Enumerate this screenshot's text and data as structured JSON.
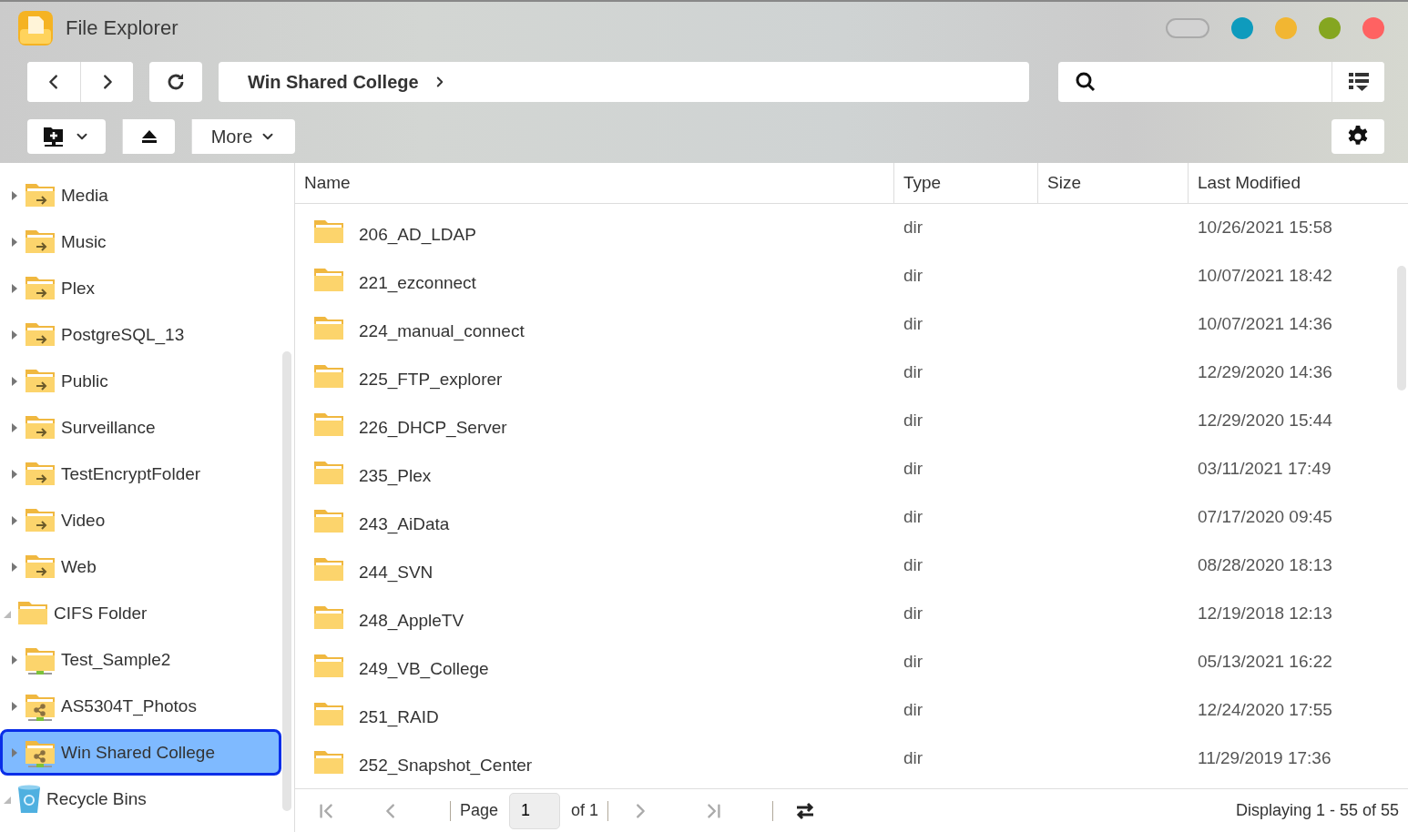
{
  "window": {
    "title": "File Explorer",
    "controls": [
      {
        "kind": "pill",
        "on": false
      },
      {
        "kind": "dot",
        "color": "#0e9bbd"
      },
      {
        "kind": "dot",
        "color": "#f2b632"
      },
      {
        "kind": "dot",
        "color": "#85a620"
      },
      {
        "kind": "dot",
        "color": "#ff6262"
      }
    ]
  },
  "toolbar": {
    "path": "Win Shared College",
    "more": "More"
  },
  "sidebar": {
    "tree": [
      {
        "children": [
          {
            "label": "Media",
            "kind": "shared",
            "expanded": false,
            "selected": false
          },
          {
            "label": "Music",
            "kind": "shared",
            "expanded": false,
            "selected": false
          },
          {
            "label": "Plex",
            "kind": "shared",
            "expanded": false,
            "selected": false
          },
          {
            "label": "PostgreSQL_13",
            "kind": "shared",
            "expanded": false,
            "selected": false
          },
          {
            "label": "Public",
            "kind": "shared",
            "expanded": false,
            "selected": false
          },
          {
            "label": "Surveillance",
            "kind": "shared",
            "expanded": false,
            "selected": false
          },
          {
            "label": "TestEncryptFolder",
            "kind": "shared",
            "expanded": false,
            "selected": false
          },
          {
            "label": "Video",
            "kind": "shared",
            "expanded": false,
            "selected": false
          },
          {
            "label": "Web",
            "kind": "shared",
            "expanded": false,
            "selected": false
          }
        ]
      },
      {
        "label": "CIFS Folder",
        "kind": "folder",
        "expanded": true,
        "selected": false,
        "children": [
          {
            "label": "Test_Sample2",
            "kind": "network",
            "expanded": false,
            "selected": false
          },
          {
            "label": "AS5304T_Photos",
            "kind": "network-share",
            "expanded": false,
            "selected": false
          },
          {
            "label": "Win Shared College",
            "kind": "network-share",
            "expanded": false,
            "selected": true
          }
        ]
      },
      {
        "label": "Recycle Bins",
        "kind": "recycle",
        "expanded": true,
        "selected": false
      }
    ]
  },
  "table": {
    "columns": [
      "Name",
      "Type",
      "Size",
      "Last Modified"
    ],
    "rows": [
      {
        "name": "206_AD_LDAP",
        "type": "dir",
        "modified": "10/26/2021 15:58"
      },
      {
        "name": "221_ezconnect",
        "type": "dir",
        "modified": "10/07/2021 18:42"
      },
      {
        "name": "224_manual_connect",
        "type": "dir",
        "modified": "10/07/2021 14:36"
      },
      {
        "name": "225_FTP_explorer",
        "type": "dir",
        "modified": "12/29/2020 14:36"
      },
      {
        "name": "226_DHCP_Server",
        "type": "dir",
        "modified": "12/29/2020 15:44"
      },
      {
        "name": "235_Plex",
        "type": "dir",
        "modified": "03/11/2021 17:49"
      },
      {
        "name": "243_AiData",
        "type": "dir",
        "modified": "07/17/2020 09:45"
      },
      {
        "name": "244_SVN",
        "type": "dir",
        "modified": "08/28/2020 18:13"
      },
      {
        "name": "248_AppleTV",
        "type": "dir",
        "modified": "12/19/2018 12:13"
      },
      {
        "name": "249_VB_College",
        "type": "dir",
        "modified": "05/13/2021 16:22"
      },
      {
        "name": "251_RAID",
        "type": "dir",
        "modified": "12/24/2020 17:55"
      },
      {
        "name": "252_Snapshot_Center",
        "type": "dir",
        "modified": "11/29/2019 17:36"
      }
    ]
  },
  "pager": {
    "page_label": "Page",
    "page": "1",
    "of": "of 1",
    "status": "Displaying 1 - 55 of 55"
  }
}
